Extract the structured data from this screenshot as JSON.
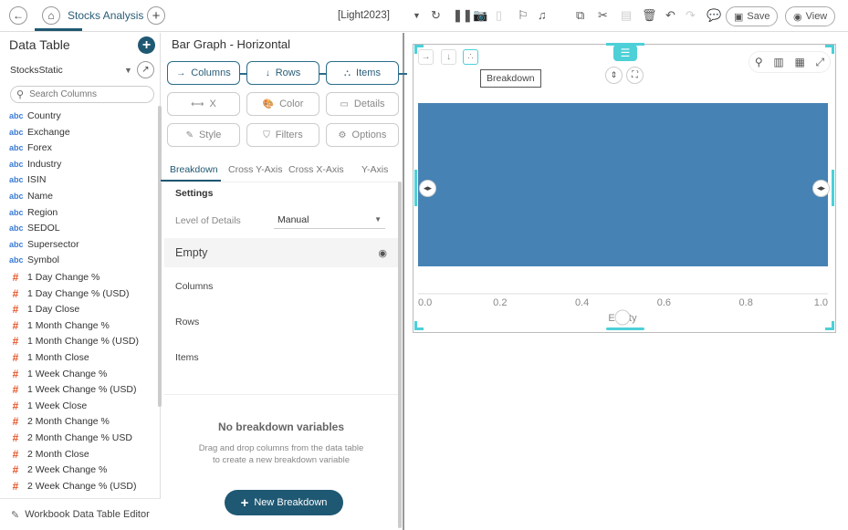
{
  "topbar": {
    "title": "Stocks Analysis",
    "theme": "[Light2023]",
    "save_label": "Save",
    "view_label": "View"
  },
  "left": {
    "title": "Data Table",
    "source": "StocksStatic",
    "search_placeholder": "Search Columns",
    "footer": "Workbook Data Table Editor",
    "fields": [
      {
        "type": "abc",
        "name": "Country"
      },
      {
        "type": "abc",
        "name": "Exchange"
      },
      {
        "type": "abc",
        "name": "Forex"
      },
      {
        "type": "abc",
        "name": "Industry"
      },
      {
        "type": "abc",
        "name": "ISIN"
      },
      {
        "type": "abc",
        "name": "Name"
      },
      {
        "type": "abc",
        "name": "Region"
      },
      {
        "type": "abc",
        "name": "SEDOL"
      },
      {
        "type": "abc",
        "name": "Supersector"
      },
      {
        "type": "abc",
        "name": "Symbol"
      },
      {
        "type": "#",
        "name": "1 Day Change %"
      },
      {
        "type": "#",
        "name": "1 Day Change % (USD)"
      },
      {
        "type": "#",
        "name": "1 Day Close"
      },
      {
        "type": "#",
        "name": "1 Month Change %"
      },
      {
        "type": "#",
        "name": "1 Month Change % (USD)"
      },
      {
        "type": "#",
        "name": "1 Month Close"
      },
      {
        "type": "#",
        "name": "1 Week Change %"
      },
      {
        "type": "#",
        "name": "1 Week Change % (USD)"
      },
      {
        "type": "#",
        "name": "1 Week Close"
      },
      {
        "type": "#",
        "name": "2 Month Change %"
      },
      {
        "type": "#",
        "name": "2 Month Change % USD"
      },
      {
        "type": "#",
        "name": "2 Month Close"
      },
      {
        "type": "#",
        "name": "2 Week Change %"
      },
      {
        "type": "#",
        "name": "2 Week Change % (USD)"
      }
    ]
  },
  "mid": {
    "title": "Bar Graph - Horizontal",
    "buttons": [
      "Columns",
      "Rows",
      "Items",
      "X",
      "Color",
      "Details",
      "Style",
      "Filters",
      "Options"
    ],
    "tabs": [
      "Breakdown",
      "Cross Y-Axis",
      "Cross X-Axis",
      "Y-Axis"
    ],
    "settings": "Settings",
    "lod_label": "Level of Details",
    "lod_value": "Manual",
    "empty": "Empty",
    "sections": [
      "Columns",
      "Rows",
      "Items"
    ],
    "no_var_title": "No breakdown variables",
    "no_var_desc1": "Drag and drop columns from the data table",
    "no_var_desc2": "to create a new breakdown variable",
    "new_button": "New Breakdown"
  },
  "right": {
    "tooltip": "Breakdown"
  },
  "chart_data": {
    "type": "bar",
    "orientation": "horizontal",
    "categories": [
      "Empty"
    ],
    "values": [
      1.0
    ],
    "xlim": [
      0,
      1
    ],
    "xticks": [
      "0.0",
      "0.2",
      "0.4",
      "0.6",
      "0.8",
      "1.0"
    ],
    "xlabel": "Empty",
    "color": "#4682b4"
  }
}
